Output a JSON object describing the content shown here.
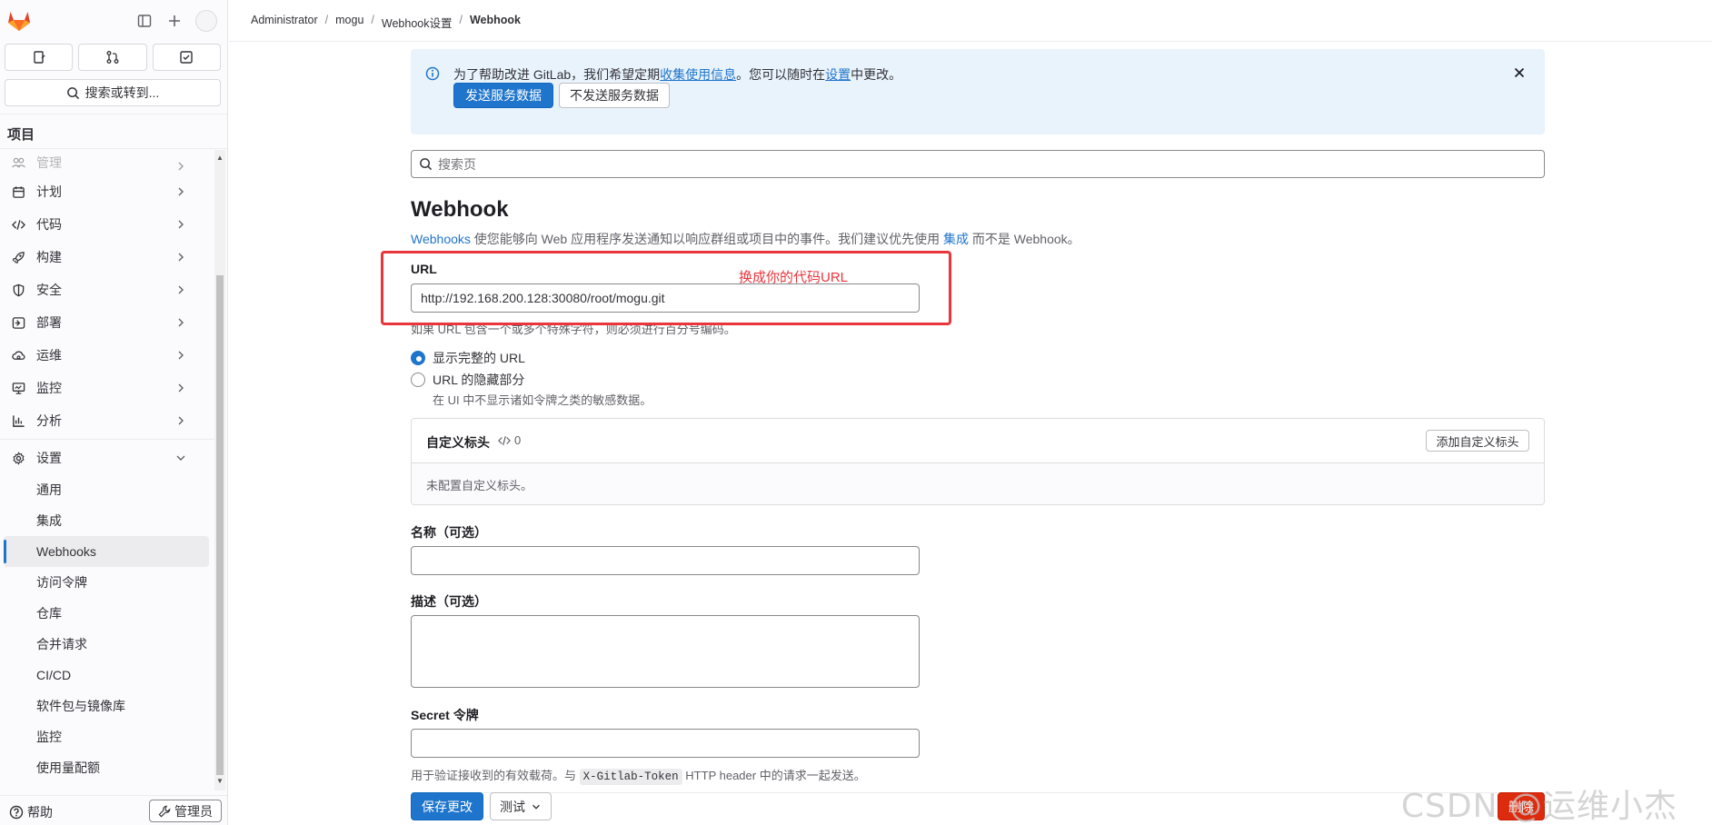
{
  "sidebar": {
    "search_label": "搜索或转到...",
    "section_title": "项目",
    "nav_items": [
      {
        "label": "管理",
        "icon": "users-icon"
      },
      {
        "label": "计划",
        "icon": "calendar-icon"
      },
      {
        "label": "代码",
        "icon": "code-icon"
      },
      {
        "label": "构建",
        "icon": "rocket-icon"
      },
      {
        "label": "安全",
        "icon": "shield-icon"
      },
      {
        "label": "部署",
        "icon": "deploy-icon"
      },
      {
        "label": "运维",
        "icon": "cloud-gear-icon"
      },
      {
        "label": "监控",
        "icon": "monitor-icon"
      },
      {
        "label": "分析",
        "icon": "chart-icon"
      },
      {
        "label": "设置",
        "icon": "settings-icon"
      }
    ],
    "settings_sub": [
      "通用",
      "集成",
      "Webhooks",
      "访问令牌",
      "仓库",
      "合并请求",
      "CI/CD",
      "软件包与镜像库",
      "监控",
      "使用量配额"
    ],
    "active_sub": "Webhooks",
    "help_label": "帮助",
    "admin_label": "管理员"
  },
  "breadcrumb": [
    "Administrator",
    "mogu",
    "Webhook设置",
    "Webhook"
  ],
  "banner": {
    "text_prefix": "为了帮助改进 GitLab，我们希望定期",
    "link1": "收集使用信息",
    "text_mid": "。您可以随时在",
    "link2": "设置",
    "text_suffix": "中更改。",
    "btn_send": "发送服务数据",
    "btn_no_send": "不发送服务数据"
  },
  "page_search_placeholder": "搜索页",
  "page_title": "Webhook",
  "desc": {
    "link1": "Webhooks",
    "text1": " 使您能够向 Web 应用程序发送通知以响应群组或项目中的事件。我们建议优先使用 ",
    "link2": "集成",
    "text2": " 而不是 Webhook。"
  },
  "url_field": {
    "label": "URL",
    "value": "http://192.168.200.128:30080/root/mogu.git",
    "help": "如果 URL 包含一个或多个特殊字符，则必须进行百分号编码。",
    "annotation": "换成你的代码URL"
  },
  "url_display": {
    "option1": "显示完整的 URL",
    "option2": "URL 的隐藏部分",
    "option2_help": "在 UI 中不显示诸如令牌之类的敏感数据。"
  },
  "custom_headers": {
    "title": "自定义标头",
    "count": "0",
    "add_button": "添加自定义标头",
    "empty": "未配置自定义标头。"
  },
  "name_field": {
    "label": "名称（可选）",
    "value": ""
  },
  "description_field": {
    "label": "描述（可选）",
    "value": ""
  },
  "secret_field": {
    "label": "Secret 令牌",
    "value": "",
    "help_prefix": "用于验证接收到的有效载荷。与",
    "help_code": "X-Gitlab-Token",
    "help_suffix": "HTTP header 中的请求一起发送。"
  },
  "actions": {
    "save": "保存更改",
    "test": "测试",
    "delete": "删除"
  },
  "watermark": "CSDN @运维小杰",
  "colors": {
    "primary": "#1f75cb",
    "danger": "#dd2b0e",
    "annotation": "#e8363c",
    "banner_bg": "#e9f3fc"
  }
}
